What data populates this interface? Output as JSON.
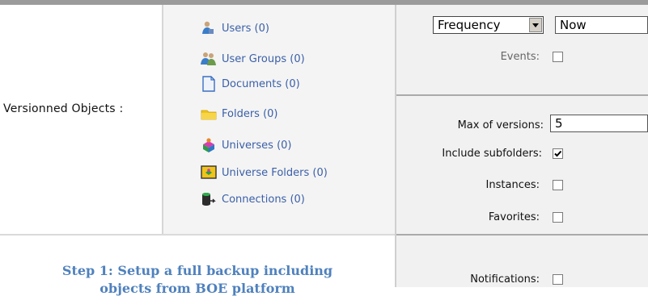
{
  "versioned_objects": {
    "label": "Versionned Objects :",
    "items": [
      {
        "label": "Users (0)",
        "icon": "users-icon"
      },
      {
        "label": "User Groups (0)",
        "icon": "user-groups-icon"
      },
      {
        "label": "Documents (0)",
        "icon": "document-icon"
      },
      {
        "label": "Folders (0)",
        "icon": "folder-icon"
      },
      {
        "label": "Universes (0)",
        "icon": "universe-icon"
      },
      {
        "label": "Universe Folders (0)",
        "icon": "universe-folder-icon"
      },
      {
        "label": "Connections (0)",
        "icon": "connection-icon"
      }
    ]
  },
  "schedule": {
    "frequency_select": "Frequency",
    "frequency_value": "Now",
    "events_label": "Events:"
  },
  "options": {
    "max_versions_label": "Max of versions:",
    "max_versions_value": "5",
    "include_subfolders_label": "Include subfolders:",
    "include_subfolders_checked": true,
    "instances_label": "Instances:",
    "instances_checked": false,
    "favorites_label": "Favorites:",
    "favorites_checked": false,
    "notifications_label": "Notifications:",
    "notifications_checked": false
  },
  "caption": {
    "line1": "Step 1: Setup a full backup including",
    "line2": "objects from BOE platform"
  },
  "colors": {
    "link": "#3a5fa8",
    "caption": "#4f81bd",
    "panel": "#f1f1f1"
  }
}
